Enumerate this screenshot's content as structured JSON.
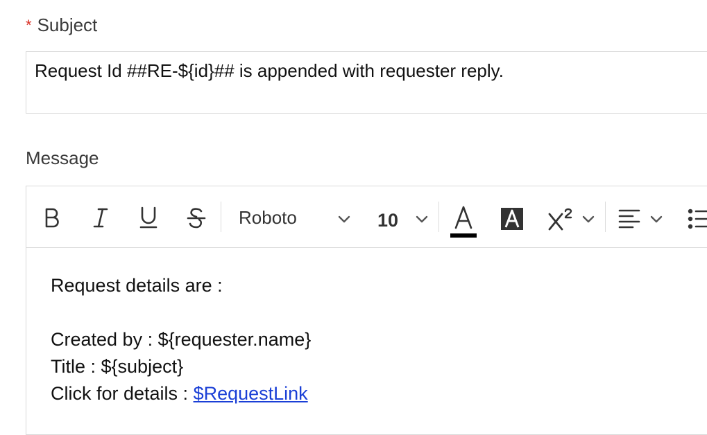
{
  "subject": {
    "required_marker": "*",
    "label": "Subject",
    "value": "Request Id ##RE-${id}## is appended with requester reply."
  },
  "message": {
    "label": "Message",
    "toolbar": {
      "font_family": "Roboto",
      "font_size": "10",
      "font_color": "#000000",
      "buttons": [
        "bold-icon",
        "italic-icon",
        "underline-icon",
        "strikethrough-icon",
        "font-family-dropdown",
        "font-size-dropdown",
        "font-color-icon",
        "background-color-icon",
        "superscript-icon",
        "align-left-icon",
        "bulleted-list-icon"
      ]
    },
    "body": {
      "line1": "Request details are :",
      "created_by": "Created by : ${requester.name}",
      "title": "Title : ${subject}",
      "click_prefix": "Click for details : ",
      "link_text": "$RequestLink"
    }
  },
  "colors": {
    "required": "#d93025",
    "link": "#1a3fd6",
    "border": "#d9d9d9"
  }
}
